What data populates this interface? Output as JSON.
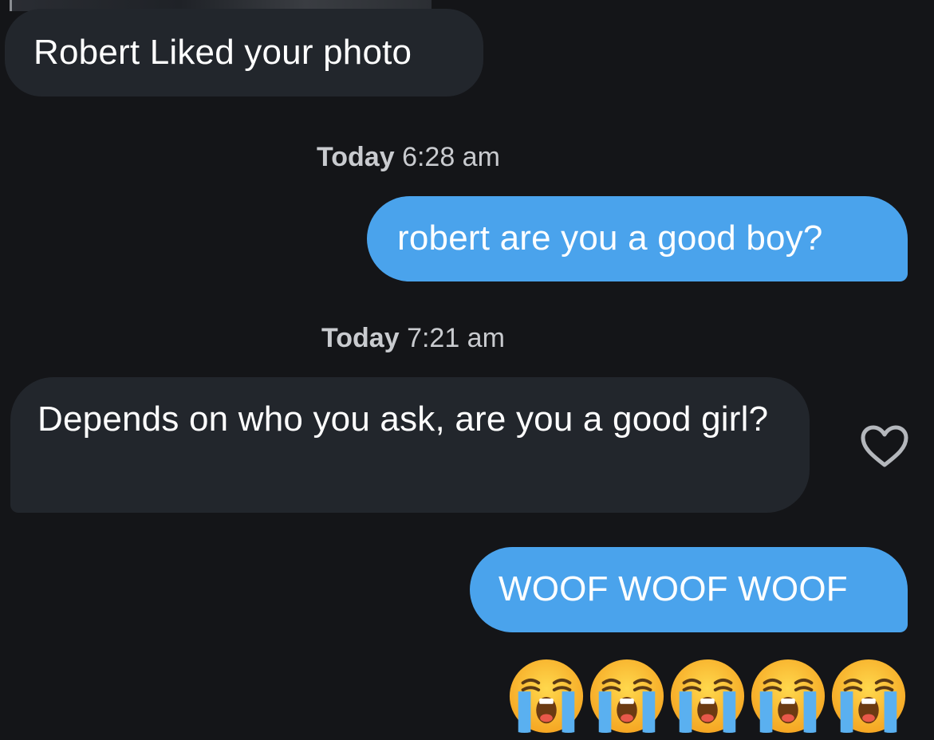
{
  "notification": {
    "liked_text": "Robert Liked your photo"
  },
  "timestamps": [
    {
      "day": "Today",
      "time": "6:28 am"
    },
    {
      "day": "Today",
      "time": "7:21 am"
    }
  ],
  "messages": [
    {
      "direction": "sent",
      "text": "robert are you a good boy?"
    },
    {
      "direction": "received",
      "text": "Depends on who you ask, are you a good girl?"
    },
    {
      "direction": "sent",
      "text": "WOOF WOOF WOOF"
    }
  ],
  "reactions": {
    "like_icon": "heart-outline-icon"
  },
  "emoji_message": {
    "emoji_name": "loudly-crying-face",
    "count": 5
  },
  "colors": {
    "background": "#141518",
    "received_bubble": "#22262c",
    "sent_bubble": "#4aa3ec",
    "timestamp_text": "#c9cbcf"
  }
}
